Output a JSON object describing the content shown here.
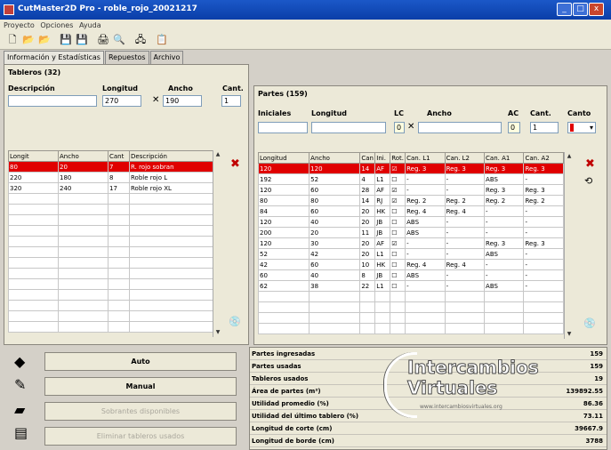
{
  "window": {
    "title": "CutMaster2D Pro - roble_rojo_20021217"
  },
  "menu": [
    "Proyecto",
    "Opciones",
    "Ayuda"
  ],
  "tabs": [
    "Información y Estadísticas",
    "Repuestos",
    "Archivo"
  ],
  "tableros": {
    "title": "Tableros (32)",
    "labels": {
      "descripcion": "Descripción",
      "longitud": "Longitud",
      "ancho": "Ancho",
      "cant": "Cant."
    },
    "inputs": {
      "descripcion": "",
      "longitud": "270",
      "ancho": "190",
      "cant": "1"
    },
    "columns": [
      "Longit",
      "Ancho",
      "Cant",
      "Descripción"
    ],
    "rows": [
      [
        "80",
        "20",
        "7",
        "R. rojo sobran"
      ],
      [
        "220",
        "180",
        "8",
        "Roble rojo L"
      ],
      [
        "320",
        "240",
        "17",
        "Roble rojo XL"
      ]
    ]
  },
  "partes": {
    "title": "Partes (159)",
    "labels": {
      "iniciales": "Iniciales",
      "longitud": "Longitud",
      "lc": "LC",
      "ancho": "Ancho",
      "ac": "AC",
      "cant": "Cant.",
      "canto": "Canto"
    },
    "inputs": {
      "iniciales": "",
      "longitud": "",
      "lc": "0",
      "ancho": "",
      "ac": "0",
      "cant": "1"
    },
    "columns": [
      "Longitud",
      "Ancho",
      "Can",
      "Ini.",
      "Rot.",
      "Can. L1",
      "Can. L2",
      "Can. A1",
      "Can. A2"
    ],
    "rows": [
      [
        "120",
        "120",
        "14",
        "AF",
        "☑",
        "Reg. 3",
        "Reg. 3",
        "Reg. 3",
        "Reg. 3"
      ],
      [
        "192",
        "52",
        "4",
        "L1",
        "☐",
        "-",
        "-",
        "ABS",
        "-"
      ],
      [
        "120",
        "60",
        "28",
        "AF",
        "☑",
        "-",
        "-",
        "Reg. 3",
        "Reg. 3"
      ],
      [
        "80",
        "80",
        "14",
        "RJ",
        "☑",
        "Reg. 2",
        "Reg. 2",
        "Reg. 2",
        "Reg. 2"
      ],
      [
        "84",
        "60",
        "20",
        "HK",
        "☐",
        "Reg. 4",
        "Reg. 4",
        "-",
        "-"
      ],
      [
        "120",
        "40",
        "20",
        "JB",
        "☐",
        "ABS",
        "-",
        "-",
        "-"
      ],
      [
        "200",
        "20",
        "11",
        "JB",
        "☐",
        "ABS",
        "-",
        "-",
        "-"
      ],
      [
        "120",
        "30",
        "20",
        "AF",
        "☑",
        "-",
        "-",
        "Reg. 3",
        "Reg. 3"
      ],
      [
        "52",
        "42",
        "20",
        "L1",
        "☐",
        "-",
        "-",
        "ABS",
        "-"
      ],
      [
        "42",
        "60",
        "10",
        "HK",
        "☐",
        "Reg. 4",
        "Reg. 4",
        "-",
        "-"
      ],
      [
        "60",
        "40",
        "8",
        "JB",
        "☐",
        "ABS",
        "-",
        "-",
        "-"
      ],
      [
        "62",
        "38",
        "22",
        "L1",
        "☐",
        "-",
        "-",
        "ABS",
        "-"
      ]
    ]
  },
  "actions": {
    "auto": "Auto",
    "manual": "Manual",
    "sobrantes": "Sobrantes disponibles",
    "eliminar": "Eliminar tableros usados"
  },
  "stats": [
    {
      "label": "Partes ingresadas",
      "value": "159"
    },
    {
      "label": "Partes usadas",
      "value": "159"
    },
    {
      "label": "Tableros usados",
      "value": "19"
    },
    {
      "label": "Área de partes (m²)",
      "value": "139892.55"
    },
    {
      "label": "Utilidad promedio (%)",
      "value": "86.36"
    },
    {
      "label": "Utilidad del último tablero (%)",
      "value": "73.11"
    },
    {
      "label": "Longitud de corte (cm)",
      "value": "39667.9"
    },
    {
      "label": "Longitud de borde (cm)",
      "value": "3788"
    }
  ],
  "watermark": {
    "line1": "Intercambios",
    "line2": "Virtuales",
    "url": "www.intercambiosvirtuales.org"
  },
  "colors": {
    "titlebar": "#0a3ea8",
    "selected_row": "#e00000",
    "delete": "#c00000"
  }
}
